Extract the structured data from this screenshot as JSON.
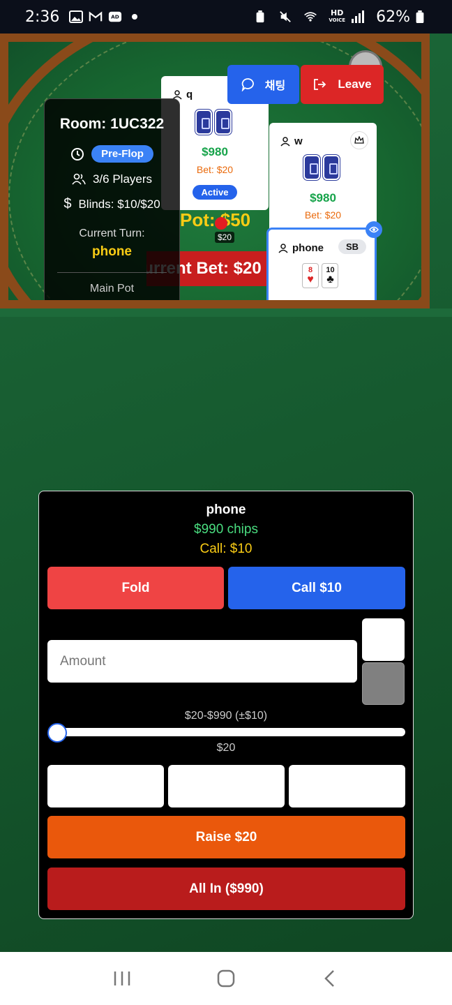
{
  "status_bar": {
    "time": "2:36",
    "hd_top": "HD",
    "hd_bottom": "VOICE",
    "battery": "62%"
  },
  "header_buttons": {
    "chat_label": "채팅",
    "leave_label": "Leave"
  },
  "room": {
    "title": "Room: 1UC322",
    "phase": "Pre-Flop",
    "players": "3/6 Players",
    "blinds": "Blinds: $10/$20",
    "turn_label": "Current Turn:",
    "turn_name": "phone",
    "main_pot": "Main Pot"
  },
  "players": [
    {
      "name": "q",
      "chips": "$980",
      "bet": "Bet: $20",
      "status": "Active"
    },
    {
      "name": "w",
      "chips": "$980",
      "bet": "Bet: $20"
    },
    {
      "name": "phone",
      "position": "SB",
      "cards": [
        {
          "rank": "8",
          "suit": "♥"
        },
        {
          "rank": "10",
          "suit": "♣"
        }
      ]
    }
  ],
  "table": {
    "pot": "Pot: $50",
    "pot_sub": "$20",
    "current_bet": "Current Bet: $20"
  },
  "action_panel": {
    "player_name": "phone",
    "chips": "$990 chips",
    "call_info": "Call: $10",
    "fold_label": "Fold",
    "call_label": "Call $10",
    "amount_placeholder": "Amount",
    "range_label": "$20-$990 (±$10)",
    "slider_value_label": "$20",
    "slider_fraction": 0.0,
    "raise_label": "Raise $20",
    "allin_label": "All In ($990)"
  },
  "colors": {
    "fold": "#ef4444",
    "call": "#2563eb",
    "raise": "#ea580c",
    "allin": "#b91c1c",
    "chips_green": "#4ade80",
    "call_yellow": "#facc15"
  }
}
